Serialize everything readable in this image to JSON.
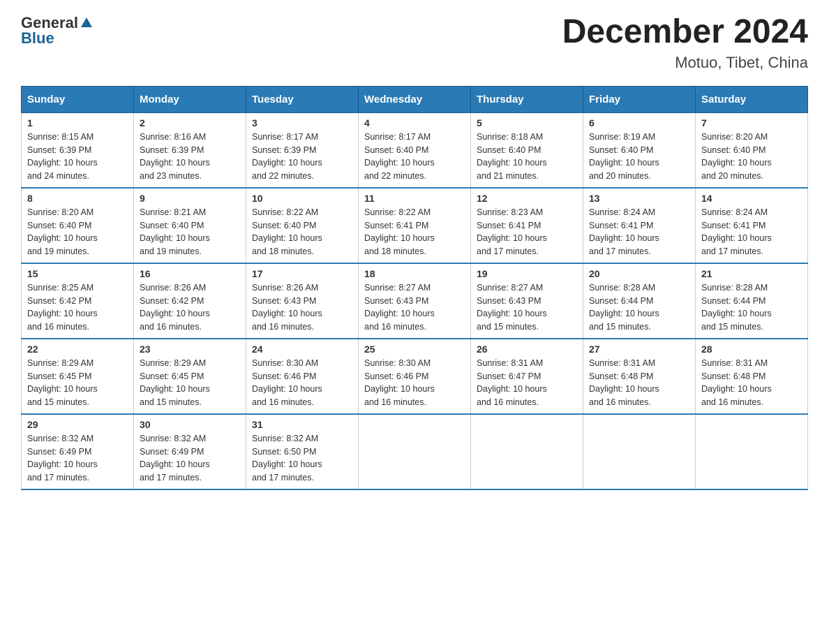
{
  "header": {
    "logo_general": "General",
    "logo_blue": "Blue",
    "month_year": "December 2024",
    "location": "Motuo, Tibet, China"
  },
  "days_of_week": [
    "Sunday",
    "Monday",
    "Tuesday",
    "Wednesday",
    "Thursday",
    "Friday",
    "Saturday"
  ],
  "weeks": [
    [
      {
        "day": 1,
        "sunrise": "8:15 AM",
        "sunset": "6:39 PM",
        "daylight": "10 hours and 24 minutes."
      },
      {
        "day": 2,
        "sunrise": "8:16 AM",
        "sunset": "6:39 PM",
        "daylight": "10 hours and 23 minutes."
      },
      {
        "day": 3,
        "sunrise": "8:17 AM",
        "sunset": "6:39 PM",
        "daylight": "10 hours and 22 minutes."
      },
      {
        "day": 4,
        "sunrise": "8:17 AM",
        "sunset": "6:40 PM",
        "daylight": "10 hours and 22 minutes."
      },
      {
        "day": 5,
        "sunrise": "8:18 AM",
        "sunset": "6:40 PM",
        "daylight": "10 hours and 21 minutes."
      },
      {
        "day": 6,
        "sunrise": "8:19 AM",
        "sunset": "6:40 PM",
        "daylight": "10 hours and 20 minutes."
      },
      {
        "day": 7,
        "sunrise": "8:20 AM",
        "sunset": "6:40 PM",
        "daylight": "10 hours and 20 minutes."
      }
    ],
    [
      {
        "day": 8,
        "sunrise": "8:20 AM",
        "sunset": "6:40 PM",
        "daylight": "10 hours and 19 minutes."
      },
      {
        "day": 9,
        "sunrise": "8:21 AM",
        "sunset": "6:40 PM",
        "daylight": "10 hours and 19 minutes."
      },
      {
        "day": 10,
        "sunrise": "8:22 AM",
        "sunset": "6:40 PM",
        "daylight": "10 hours and 18 minutes."
      },
      {
        "day": 11,
        "sunrise": "8:22 AM",
        "sunset": "6:41 PM",
        "daylight": "10 hours and 18 minutes."
      },
      {
        "day": 12,
        "sunrise": "8:23 AM",
        "sunset": "6:41 PM",
        "daylight": "10 hours and 17 minutes."
      },
      {
        "day": 13,
        "sunrise": "8:24 AM",
        "sunset": "6:41 PM",
        "daylight": "10 hours and 17 minutes."
      },
      {
        "day": 14,
        "sunrise": "8:24 AM",
        "sunset": "6:41 PM",
        "daylight": "10 hours and 17 minutes."
      }
    ],
    [
      {
        "day": 15,
        "sunrise": "8:25 AM",
        "sunset": "6:42 PM",
        "daylight": "10 hours and 16 minutes."
      },
      {
        "day": 16,
        "sunrise": "8:26 AM",
        "sunset": "6:42 PM",
        "daylight": "10 hours and 16 minutes."
      },
      {
        "day": 17,
        "sunrise": "8:26 AM",
        "sunset": "6:43 PM",
        "daylight": "10 hours and 16 minutes."
      },
      {
        "day": 18,
        "sunrise": "8:27 AM",
        "sunset": "6:43 PM",
        "daylight": "10 hours and 16 minutes."
      },
      {
        "day": 19,
        "sunrise": "8:27 AM",
        "sunset": "6:43 PM",
        "daylight": "10 hours and 15 minutes."
      },
      {
        "day": 20,
        "sunrise": "8:28 AM",
        "sunset": "6:44 PM",
        "daylight": "10 hours and 15 minutes."
      },
      {
        "day": 21,
        "sunrise": "8:28 AM",
        "sunset": "6:44 PM",
        "daylight": "10 hours and 15 minutes."
      }
    ],
    [
      {
        "day": 22,
        "sunrise": "8:29 AM",
        "sunset": "6:45 PM",
        "daylight": "10 hours and 15 minutes."
      },
      {
        "day": 23,
        "sunrise": "8:29 AM",
        "sunset": "6:45 PM",
        "daylight": "10 hours and 15 minutes."
      },
      {
        "day": 24,
        "sunrise": "8:30 AM",
        "sunset": "6:46 PM",
        "daylight": "10 hours and 16 minutes."
      },
      {
        "day": 25,
        "sunrise": "8:30 AM",
        "sunset": "6:46 PM",
        "daylight": "10 hours and 16 minutes."
      },
      {
        "day": 26,
        "sunrise": "8:31 AM",
        "sunset": "6:47 PM",
        "daylight": "10 hours and 16 minutes."
      },
      {
        "day": 27,
        "sunrise": "8:31 AM",
        "sunset": "6:48 PM",
        "daylight": "10 hours and 16 minutes."
      },
      {
        "day": 28,
        "sunrise": "8:31 AM",
        "sunset": "6:48 PM",
        "daylight": "10 hours and 16 minutes."
      }
    ],
    [
      {
        "day": 29,
        "sunrise": "8:32 AM",
        "sunset": "6:49 PM",
        "daylight": "10 hours and 17 minutes."
      },
      {
        "day": 30,
        "sunrise": "8:32 AM",
        "sunset": "6:49 PM",
        "daylight": "10 hours and 17 minutes."
      },
      {
        "day": 31,
        "sunrise": "8:32 AM",
        "sunset": "6:50 PM",
        "daylight": "10 hours and 17 minutes."
      },
      null,
      null,
      null,
      null
    ]
  ],
  "labels": {
    "sunrise": "Sunrise:",
    "sunset": "Sunset:",
    "daylight": "Daylight:"
  }
}
